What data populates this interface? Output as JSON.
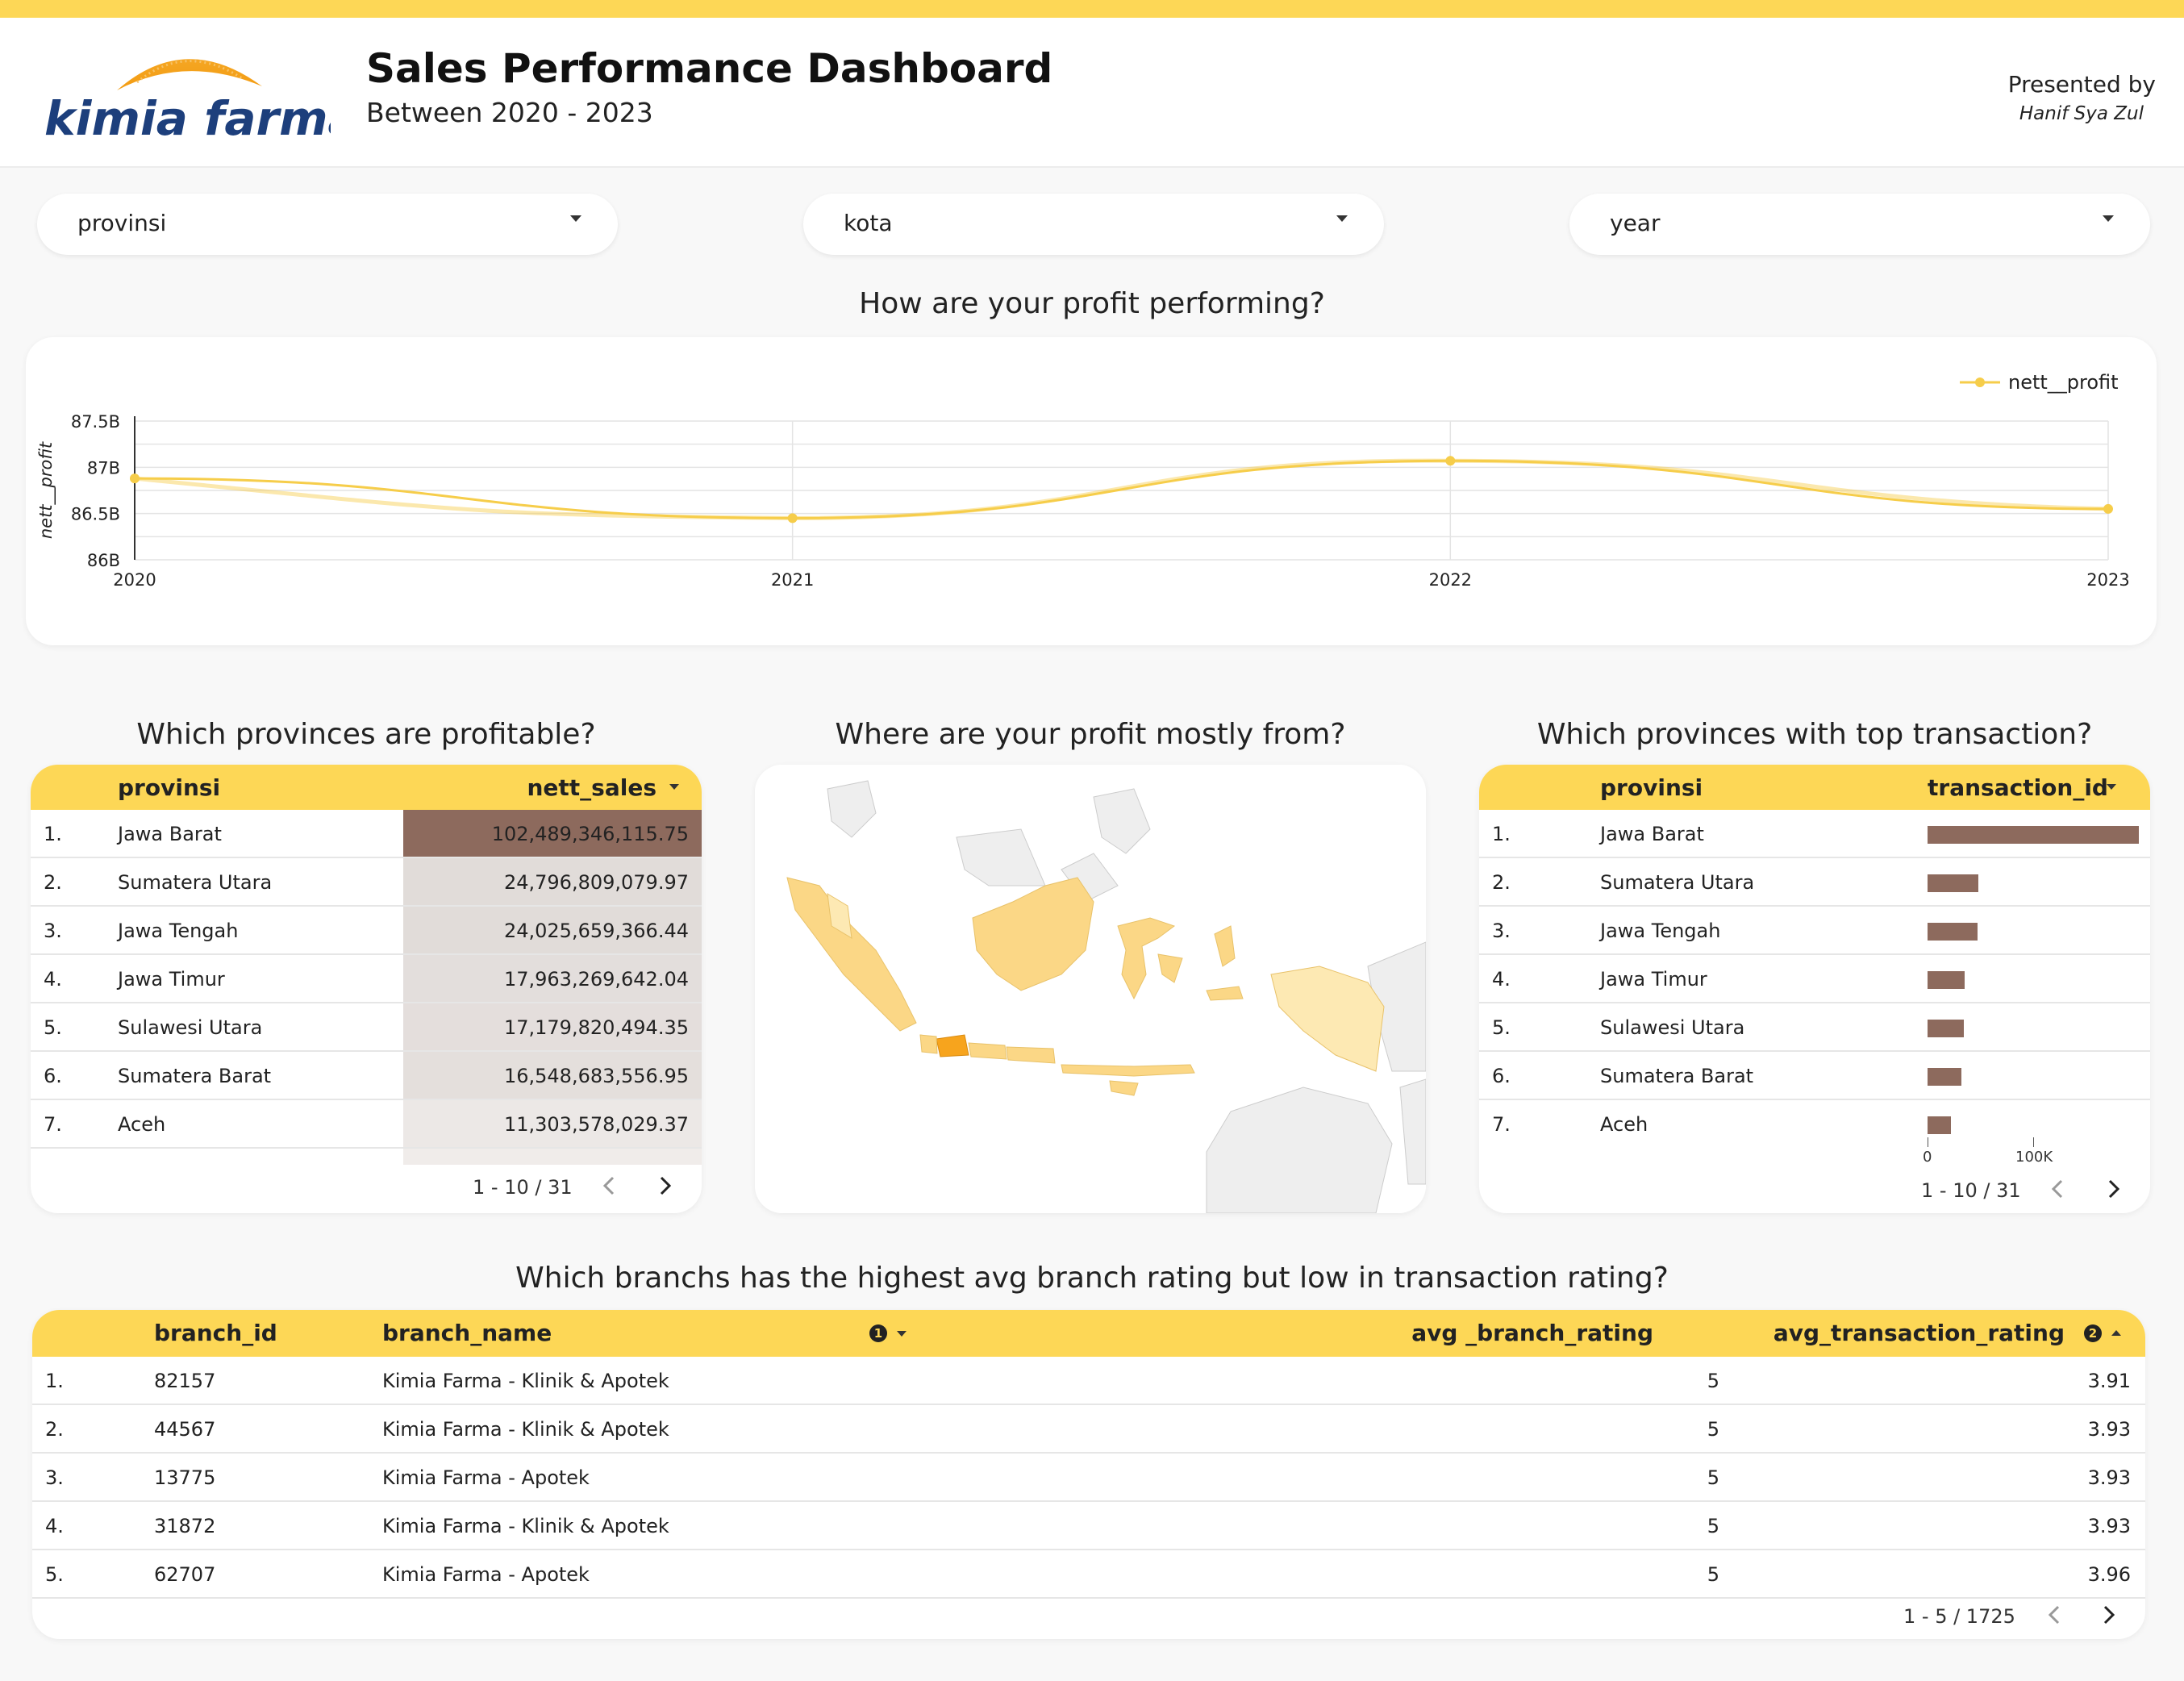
{
  "colors": {
    "accent": "#fdd756",
    "line": "#f6cd4a",
    "bar": "#8d6a5d",
    "heat_max": "#8d6a5d",
    "heat_low": "#e5e0de",
    "map_high": "#f7a41d",
    "map_mid": "#fbd786",
    "map_low": "#fde9b3",
    "map_none": "#eeeeee"
  },
  "header": {
    "logo_text": "kimia farma",
    "title": "Sales Performance Dashboard",
    "subtitle": "Between 2020 - 2023",
    "presented_label": "Presented by",
    "presenter": "Hanif Sya Zul"
  },
  "filters": [
    {
      "label": "provinsi"
    },
    {
      "label": "kota"
    },
    {
      "label": "year"
    }
  ],
  "profit_section": {
    "title": "How are your profit performing?"
  },
  "chart_data": {
    "type": "line",
    "x": [
      2020,
      2021,
      2022,
      2023
    ],
    "x_tick_labels": [
      "2020",
      "2021",
      "2022",
      "2023"
    ],
    "series": [
      {
        "name": "nett__profit",
        "values": [
          86.88,
          86.45,
          87.07,
          86.55
        ]
      }
    ],
    "ylabel": "nett__profit",
    "ylim": [
      86,
      87.5
    ],
    "y_ticks": [
      86,
      86.5,
      87,
      87.5
    ],
    "y_tick_labels": [
      "86B",
      "86.5B",
      "87B",
      "87.5B"
    ],
    "legend": "top-right",
    "grid": true,
    "trendline": true
  },
  "provinces_table": {
    "title": "Which provinces are profitable?",
    "columns": [
      "provinsi",
      "nett_sales"
    ],
    "rows": [
      {
        "idx": "1.",
        "provinsi": "Jawa Barat",
        "nett_sales": "102,489,346,115.75",
        "value": 102489346115.75
      },
      {
        "idx": "2.",
        "provinsi": "Sumatera Utara",
        "nett_sales": "24,796,809,079.97",
        "value": 24796809079.97
      },
      {
        "idx": "3.",
        "provinsi": "Jawa Tengah",
        "nett_sales": "24,025,659,366.44",
        "value": 24025659366.44
      },
      {
        "idx": "4.",
        "provinsi": "Jawa Timur",
        "nett_sales": "17,963,269,642.04",
        "value": 17963269642.04
      },
      {
        "idx": "5.",
        "provinsi": "Sulawesi Utara",
        "nett_sales": "17,179,820,494.35",
        "value": 17179820494.35
      },
      {
        "idx": "6.",
        "provinsi": "Sumatera Barat",
        "nett_sales": "16,548,683,556.95",
        "value": 16548683556.95
      },
      {
        "idx": "7.",
        "provinsi": "Aceh",
        "nett_sales": "11,303,578,029.37",
        "value": 11303578029.37
      }
    ],
    "pagination": "1 - 10 / 31"
  },
  "map_section": {
    "title": "Where are your profit mostly from?"
  },
  "transactions_table": {
    "title": "Which provinces with top transaction?",
    "columns": [
      "provinsi",
      "transaction_id"
    ],
    "rows": [
      {
        "idx": "1.",
        "provinsi": "Jawa Barat",
        "value": 100
      },
      {
        "idx": "2.",
        "provinsi": "Sumatera Utara",
        "value": 24
      },
      {
        "idx": "3.",
        "provinsi": "Jawa Tengah",
        "value": 23.5
      },
      {
        "idx": "4.",
        "provinsi": "Jawa Timur",
        "value": 17.5
      },
      {
        "idx": "5.",
        "provinsi": "Sulawesi Utara",
        "value": 17
      },
      {
        "idx": "6.",
        "provinsi": "Sumatera Barat",
        "value": 16
      },
      {
        "idx": "7.",
        "provinsi": "Aceh",
        "value": 11
      }
    ],
    "axis": {
      "max": 100,
      "ticks": [
        {
          "value": 0,
          "label": "0"
        },
        {
          "value": 100,
          "label": "100K"
        }
      ]
    },
    "pagination": "1 - 10 / 31"
  },
  "branch_table": {
    "title": "Which branchs has the highest avg branch rating but low in transaction rating?",
    "columns": [
      "branch_id",
      "branch_name",
      "avg _branch_rating",
      "avg_transaction_rating"
    ],
    "rows": [
      {
        "idx": "1.",
        "branch_id": "82157",
        "branch_name": "Kimia Farma - Klinik & Apotek",
        "avg_branch_rating": "5",
        "avg_transaction_rating": "3.91"
      },
      {
        "idx": "2.",
        "branch_id": "44567",
        "branch_name": "Kimia Farma - Klinik & Apotek",
        "avg_branch_rating": "5",
        "avg_transaction_rating": "3.93"
      },
      {
        "idx": "3.",
        "branch_id": "13775",
        "branch_name": "Kimia Farma - Apotek",
        "avg_branch_rating": "5",
        "avg_transaction_rating": "3.93"
      },
      {
        "idx": "4.",
        "branch_id": "31872",
        "branch_name": "Kimia Farma - Klinik & Apotek",
        "avg_branch_rating": "5",
        "avg_transaction_rating": "3.93"
      },
      {
        "idx": "5.",
        "branch_id": "62707",
        "branch_name": "Kimia Farma - Apotek",
        "avg_branch_rating": "5",
        "avg_transaction_rating": "3.96"
      }
    ],
    "pagination": "1 - 5 / 1725"
  }
}
